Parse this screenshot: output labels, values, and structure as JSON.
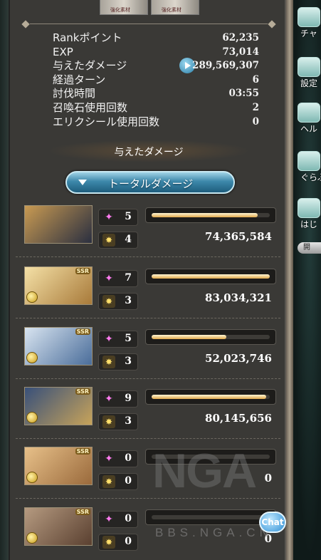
{
  "top_items": [
    "強化素材",
    "強化素材"
  ],
  "stats": [
    {
      "label": "Rankポイント",
      "value": "62,235"
    },
    {
      "label": "EXP",
      "value": "73,014"
    },
    {
      "label": "与えたダメージ",
      "value": "289,569,307"
    },
    {
      "label": "経過ターン",
      "value": "6"
    },
    {
      "label": "討伐時間",
      "value": "03:55"
    },
    {
      "label": "召喚石使用回数",
      "value": "2"
    },
    {
      "label": "エリクシール使用回数",
      "value": "0"
    }
  ],
  "damage_heading": "与えたダメージ",
  "total_damage_button": "トータルダメージ",
  "members": [
    {
      "ssr": "",
      "skill_uses": "5",
      "chain_bursts": "4",
      "damage": "74,365,584",
      "damage_fraction": 0.9,
      "portrait_colors": [
        "#c89a52",
        "#2a2f40"
      ]
    },
    {
      "ssr": "SSR",
      "skill_uses": "7",
      "chain_bursts": "3",
      "damage": "83,034,321",
      "damage_fraction": 1.0,
      "portrait_colors": [
        "#f4e0a6",
        "#a87a3a"
      ]
    },
    {
      "ssr": "SSR",
      "skill_uses": "5",
      "chain_bursts": "3",
      "damage": "52,023,746",
      "damage_fraction": 0.63,
      "portrait_colors": [
        "#d8e4f0",
        "#4a6d9a"
      ]
    },
    {
      "ssr": "SSR",
      "skill_uses": "9",
      "chain_bursts": "3",
      "damage": "80,145,656",
      "damage_fraction": 0.97,
      "portrait_colors": [
        "#38507a",
        "#c7a35a"
      ]
    },
    {
      "ssr": "SSR",
      "skill_uses": "0",
      "chain_bursts": "0",
      "damage": "0",
      "damage_fraction": 0.0,
      "portrait_colors": [
        "#e7c089",
        "#9a6a3c"
      ]
    },
    {
      "ssr": "SSR",
      "skill_uses": "0",
      "chain_bursts": "0",
      "damage": "0",
      "damage_fraction": 0.0,
      "portrait_colors": [
        "#b59a80",
        "#5a4030"
      ]
    }
  ],
  "sidebar": {
    "items": [
      {
        "label": "チャ",
        "icon": "chat-icon"
      },
      {
        "label": "設定",
        "icon": "settings-gear-icon"
      },
      {
        "label": "ヘル",
        "icon": "help-book-icon"
      },
      {
        "label": "ぐらぶ",
        "icon": "grablue-fairy-icon"
      },
      {
        "label": "はじ",
        "icon": "beginner-character-icon"
      }
    ],
    "open_button": "開"
  },
  "watermark": {
    "logo": "NGA",
    "url": "BBS.NGA.CN"
  },
  "chat_button": "Chat"
}
